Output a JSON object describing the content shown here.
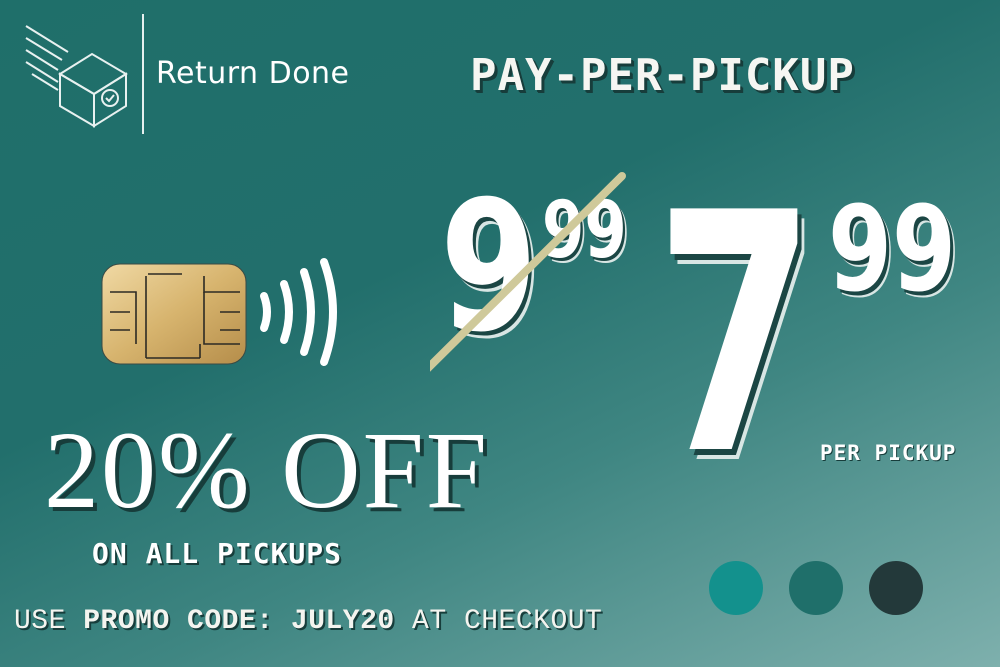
{
  "brand": {
    "name": "Return Done",
    "logo_icon": "box-icon"
  },
  "headline": "PAY-PER-PICKUP",
  "price": {
    "old_whole": "9",
    "old_cents": "99",
    "new_whole": "7",
    "new_cents": "99",
    "unit": "PER PICKUP"
  },
  "discount": {
    "title": "20% OFF",
    "subtitle": "ON ALL PICKUPS"
  },
  "promo": {
    "prefix": "USE",
    "label": "PROMO CODE:",
    "code": "JULY20",
    "suffix": "AT CHECKOUT"
  },
  "icons": [
    "box-icon",
    "chip-card-icon",
    "contactless-icon"
  ],
  "colors": {
    "background": "#226f6c",
    "text": "#ffffff",
    "strike": "#cfc99a",
    "card_gold": "#d7b46e",
    "swatches": [
      "#13918d",
      "#1f6f6a",
      "#23393a"
    ]
  }
}
